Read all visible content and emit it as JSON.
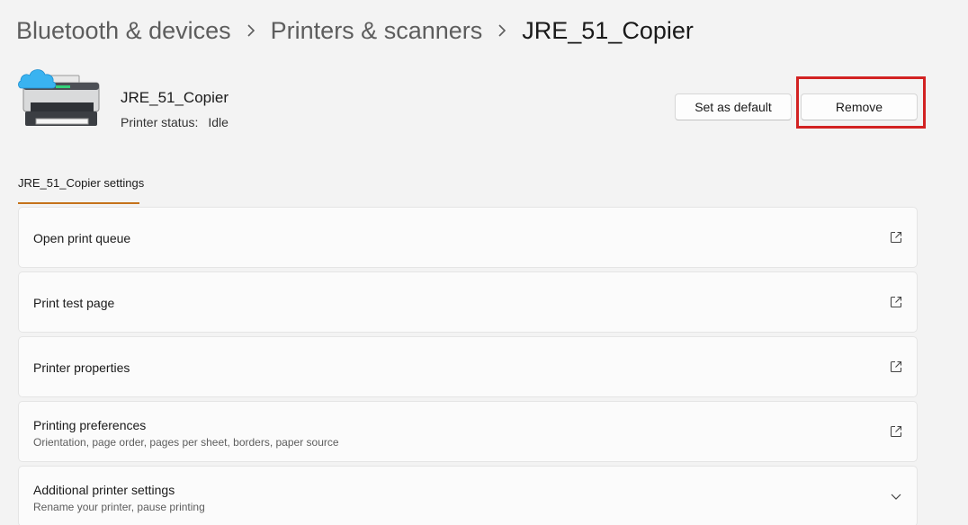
{
  "breadcrumb": {
    "items": [
      "Bluetooth & devices",
      "Printers & scanners",
      "JRE_51_Copier"
    ]
  },
  "printer": {
    "name": "JRE_51_Copier",
    "status_label": "Printer status:",
    "status_value": "Idle",
    "icon": "printer-cloud-icon"
  },
  "actions": {
    "set_default_label": "Set as default",
    "remove_label": "Remove"
  },
  "tab": {
    "label": "JRE_51_Copier settings"
  },
  "settings": [
    {
      "title": "Open print queue",
      "subtitle": "",
      "icon": "external-link-icon"
    },
    {
      "title": "Print test page",
      "subtitle": "",
      "icon": "external-link-icon"
    },
    {
      "title": "Printer properties",
      "subtitle": "",
      "icon": "external-link-icon"
    },
    {
      "title": "Printing preferences",
      "subtitle": "Orientation, page order, pages per sheet, borders, paper source",
      "icon": "external-link-icon"
    },
    {
      "title": "Additional printer settings",
      "subtitle": "Rename your printer, pause printing",
      "icon": "chevron-down-icon"
    }
  ],
  "colors": {
    "background": "#f3f3f3",
    "card": "#fbfbfb",
    "accent_underline": "#c5721a",
    "highlight": "#d22222"
  }
}
